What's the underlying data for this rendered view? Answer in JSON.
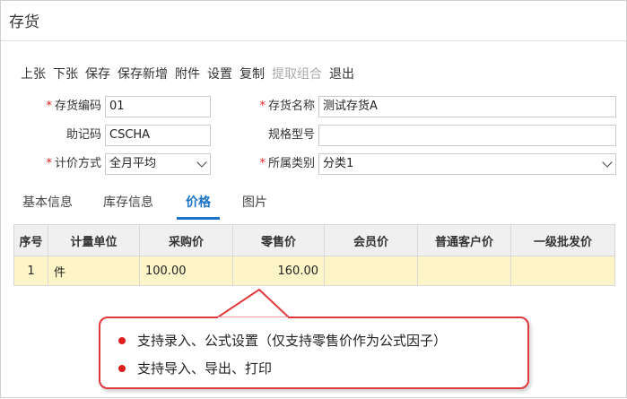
{
  "window": {
    "title": "存货"
  },
  "toolbar": {
    "buttons": [
      "上张",
      "下张",
      "保存",
      "保存新增",
      "附件",
      "设置",
      "复制",
      "提取组合",
      "退出"
    ]
  },
  "form": {
    "code_label": "存货编码",
    "code_value": "01",
    "name_label": "存货名称",
    "name_value": "测试存货A",
    "mnemonic_label": "助记码",
    "mnemonic_value": "CSCHA",
    "spec_label": "规格型号",
    "spec_value": "",
    "pricing_label": "计价方式",
    "pricing_value": "全月平均",
    "category_label": "所属类别",
    "category_value": "分类1"
  },
  "tabs": [
    "基本信息",
    "库存信息",
    "价格",
    "图片"
  ],
  "active_tab": "价格",
  "price_table": {
    "columns": [
      "序号",
      "计量单位",
      "采购价",
      "零售价",
      "会员价",
      "普通客户价",
      "一级批发价"
    ],
    "rows": [
      [
        "1",
        "件",
        "100.00",
        "160.00",
        "",
        "",
        ""
      ]
    ]
  },
  "callout": {
    "items": [
      "支持录入、公式设置（仅支持零售价作为公式因子）",
      "支持导入、导出、打印"
    ]
  },
  "colors": {
    "accent": "#1a73c9",
    "required": "#e02020",
    "callout_border": "#e0383c",
    "row_highlight": "#fdf5c7"
  }
}
